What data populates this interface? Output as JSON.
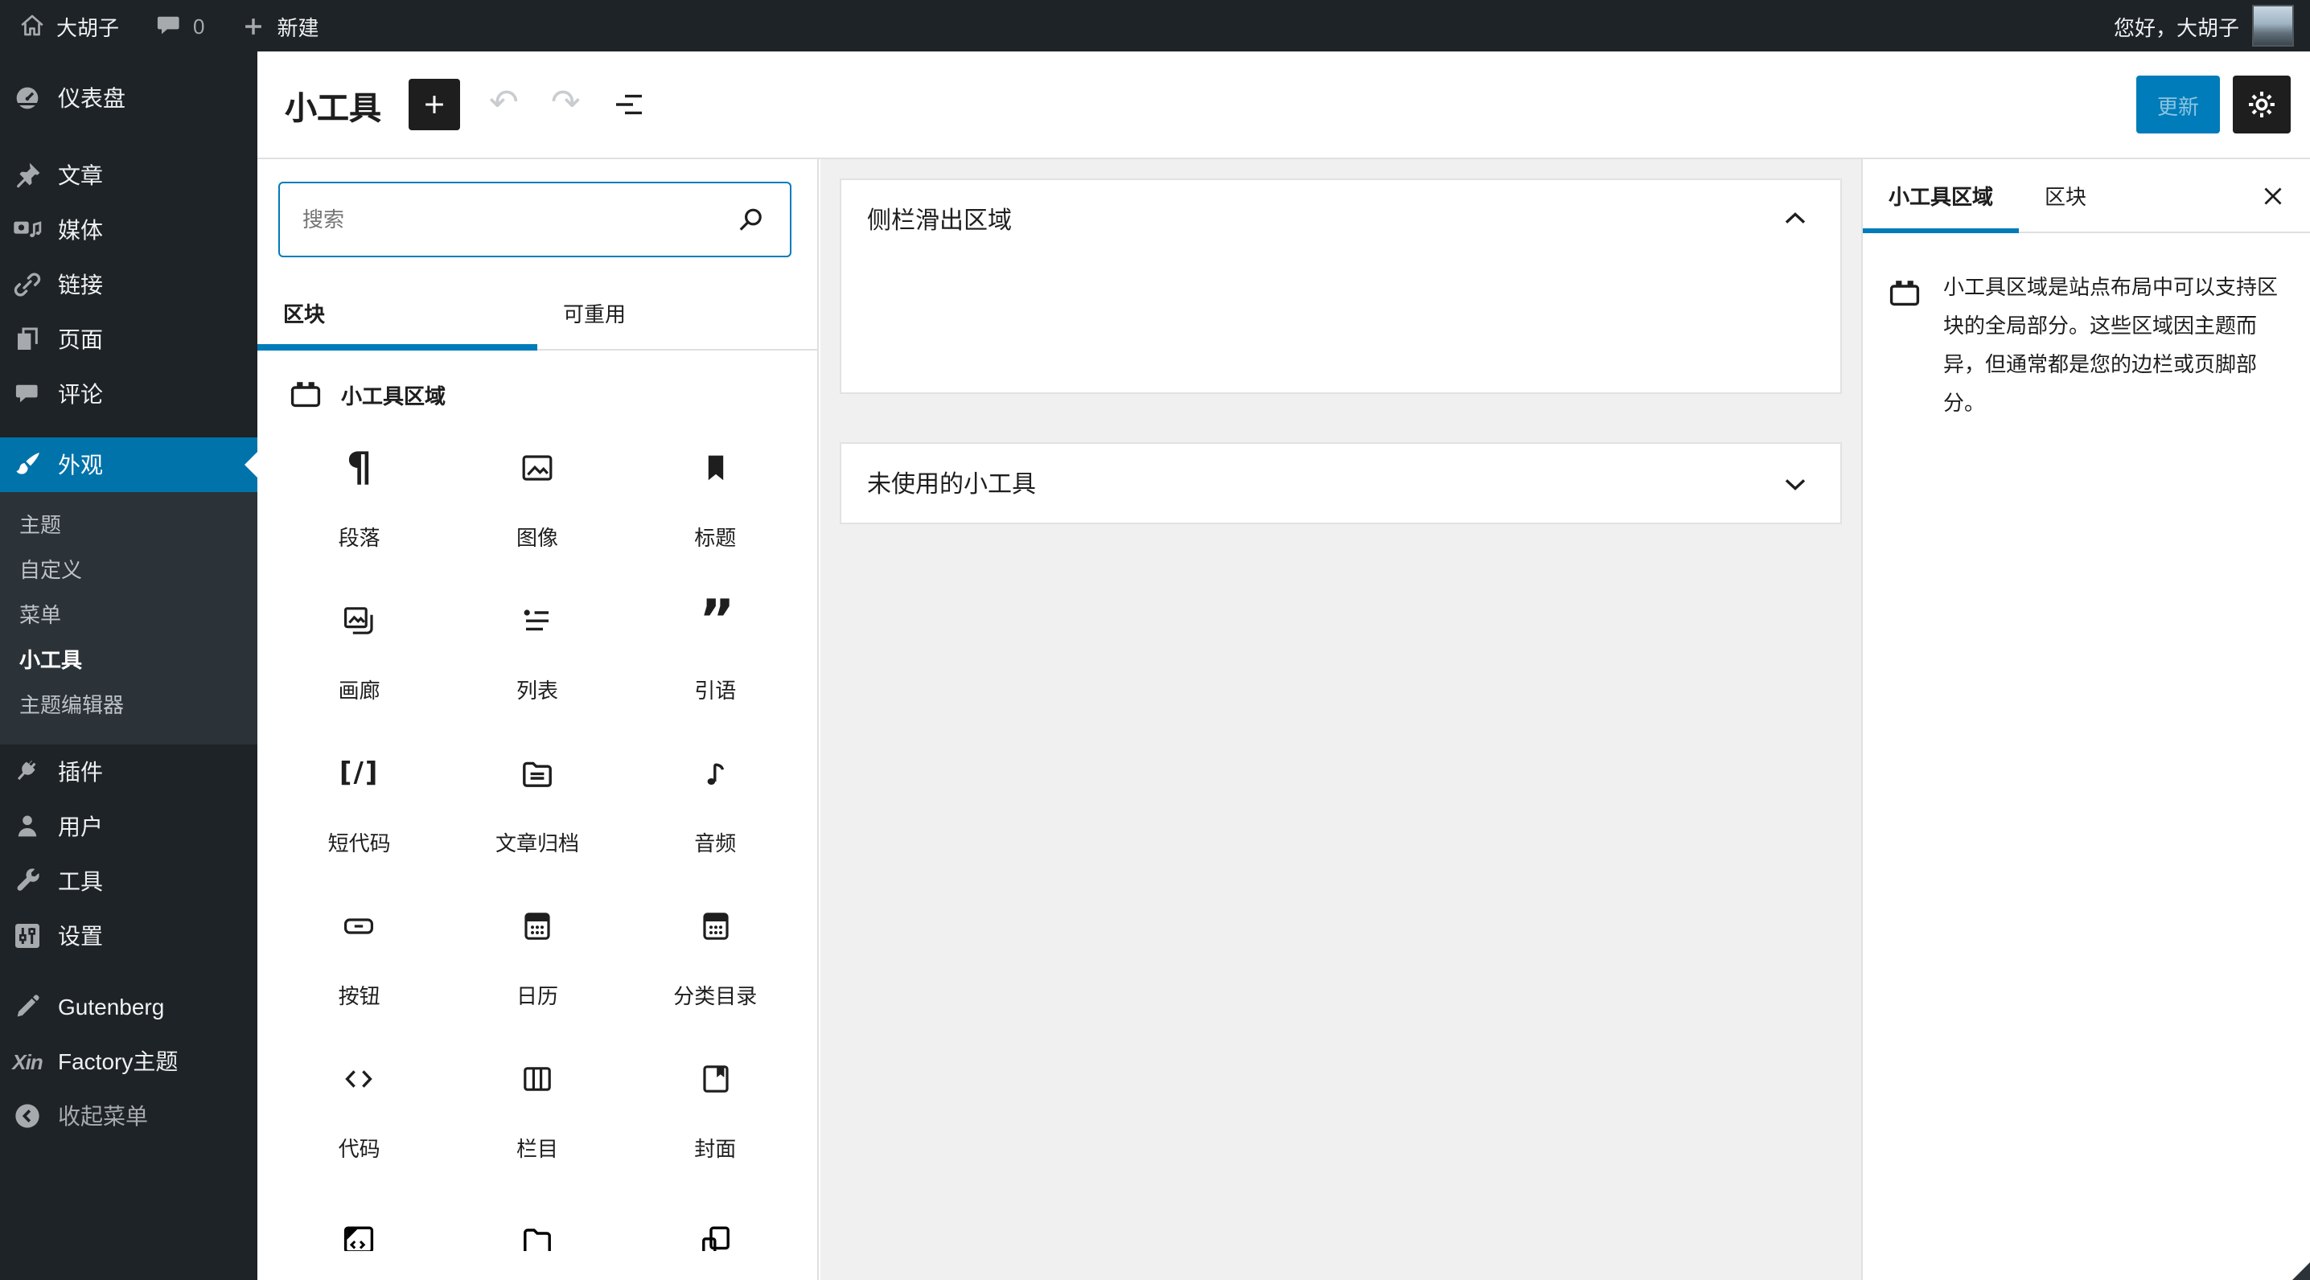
{
  "admin_bar": {
    "site_name": "大胡子",
    "comment_count": "0",
    "new_label": "新建",
    "greeting": "您好，大胡子"
  },
  "sidebar": {
    "group1": [
      {
        "label": "仪表盘",
        "icon": "dashboard"
      }
    ],
    "group2": [
      {
        "label": "文章",
        "icon": "pin"
      },
      {
        "label": "媒体",
        "icon": "media"
      },
      {
        "label": "链接",
        "icon": "link"
      },
      {
        "label": "页面",
        "icon": "pages"
      },
      {
        "label": "评论",
        "icon": "comment"
      }
    ],
    "appearance": {
      "label": "外观",
      "icon": "brush",
      "submenu": [
        {
          "label": "主题",
          "current": false
        },
        {
          "label": "自定义",
          "current": false
        },
        {
          "label": "菜单",
          "current": false
        },
        {
          "label": "小工具",
          "current": true
        },
        {
          "label": "主题编辑器",
          "current": false
        }
      ]
    },
    "group3": [
      {
        "label": "插件",
        "icon": "plug"
      },
      {
        "label": "用户",
        "icon": "user"
      },
      {
        "label": "工具",
        "icon": "wrench"
      },
      {
        "label": "设置",
        "icon": "sliders"
      }
    ],
    "group4": [
      {
        "label": "Gutenberg",
        "icon": "pencil"
      },
      {
        "label": "Factory主题",
        "icon": "xin"
      }
    ],
    "collapse": {
      "label": "收起菜单",
      "icon": "collapse"
    }
  },
  "header": {
    "title": "小工具",
    "update_label": "更新"
  },
  "inserter": {
    "search_placeholder": "搜索",
    "tabs": {
      "blocks": "区块",
      "reusable": "可重用"
    },
    "section_title": "小工具区域",
    "blocks": [
      {
        "label": "段落",
        "icon": "paragraph"
      },
      {
        "label": "图像",
        "icon": "image"
      },
      {
        "label": "标题",
        "icon": "heading"
      },
      {
        "label": "画廊",
        "icon": "gallery"
      },
      {
        "label": "列表",
        "icon": "list"
      },
      {
        "label": "引语",
        "icon": "quote"
      },
      {
        "label": "短代码",
        "icon": "shortcode"
      },
      {
        "label": "文章归档",
        "icon": "archives"
      },
      {
        "label": "音频",
        "icon": "audio"
      },
      {
        "label": "按钮",
        "icon": "button"
      },
      {
        "label": "日历",
        "icon": "calendar"
      },
      {
        "label": "分类目录",
        "icon": "categories"
      },
      {
        "label": "代码",
        "icon": "code"
      },
      {
        "label": "栏目",
        "icon": "columns"
      },
      {
        "label": "封面",
        "icon": "cover"
      }
    ],
    "partial_blocks": [
      {
        "icon": "html"
      },
      {
        "icon": "folder"
      },
      {
        "icon": "group"
      }
    ]
  },
  "canvas": {
    "panels": [
      {
        "title": "侧栏滑出区域",
        "state": "expanded"
      },
      {
        "title": "未使用的小工具",
        "state": "collapsed"
      }
    ]
  },
  "right_sidebar": {
    "tabs": {
      "widget_area": "小工具区域",
      "block": "区块"
    },
    "description": "小工具区域是站点布局中可以支持区块的全局部分。这些区域因主题而异，但通常都是您的边栏或页脚部分。"
  },
  "colors": {
    "accent_blue": "#007cba",
    "menu_highlight_blue": "#0073aa",
    "admin_dark": "#1d2327",
    "submenu_dark": "#2c3338",
    "canvas_gray": "#f0f0f1"
  }
}
